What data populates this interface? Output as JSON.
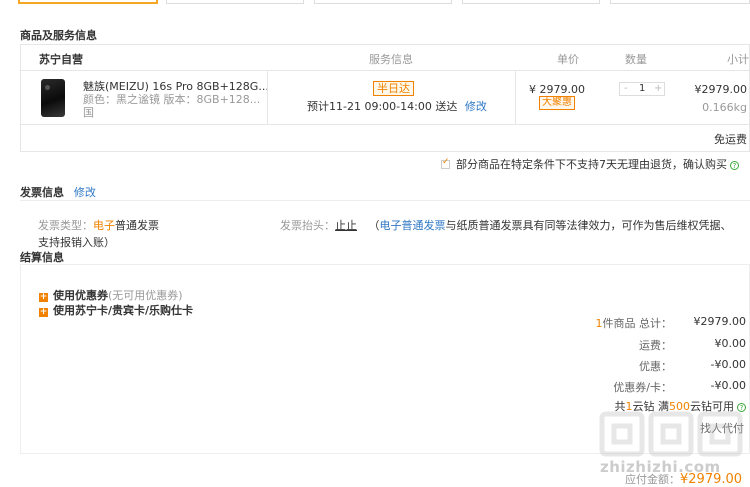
{
  "section_goods_title": "商品及服务信息",
  "table": {
    "seller": "苏宁自营",
    "col_service": "服务信息",
    "col_price": "单价",
    "col_qty": "数量",
    "col_subtotal": "小计"
  },
  "product": {
    "name": "魅族(MEIZU) 16s Pro 8GB+128G...",
    "spec_line": "颜色：黑之谧镜  版本：8GB+128...",
    "spec_more": "国",
    "service_badge": "半日达",
    "eta": "预计11-21 09:00-14:00 送达",
    "eta_edit": "修改",
    "unit_price": "¥ 2979.00",
    "promo_tag": "大聚惠",
    "qty_minus": "-",
    "qty": "1",
    "qty_plus": "+",
    "subtotal": "¥2979.00",
    "weight": "0.166kg",
    "shipping": "免运费"
  },
  "notice": {
    "text": "部分商品在特定条件下不支持7天无理由退货，确认购买",
    "help_icon": "question-circle-icon"
  },
  "invoice": {
    "title": "发票信息",
    "edit": "修改",
    "type_label": "发票类型：",
    "type_value_highlight": "电子",
    "type_value_rest": "普通发票",
    "header_label": "发票抬头：",
    "header_value": "止止",
    "note_prefix": "（",
    "note_link": "电子普通发票",
    "note_text": "与纸质普通发票具有同等法律效力，可作为售后维权凭据、",
    "note_line2": "支持报销入账）"
  },
  "settlement": {
    "title": "结算信息",
    "coupon_label": "使用优惠券",
    "coupon_note": "(无可用优惠券)",
    "card_label": "使用苏宁卡/贵宾卡/乐购仕卡",
    "items_count": "1",
    "items_label": "件商品 总计：",
    "items_total": "¥2979.00",
    "freight_label": "运费：",
    "freight_value": "¥0.00",
    "discount_label": "优惠：",
    "discount_value": "-¥0.00",
    "coupon_card_label": "优惠券/卡：",
    "coupon_card_value": "-¥0.00",
    "yun_prefix": "共",
    "yun_count": "1",
    "yun_mid": "云钻 满",
    "yun_threshold": "500",
    "yun_suffix": "云钻可用",
    "pay_text": "找人代付",
    "payable_label": "应付金额：",
    "payable_value": "¥2979.00"
  },
  "watermark": "zhizhizhi.com",
  "colors": {
    "accent": "#f08200",
    "link": "#2f78c4",
    "border": "#e6e6e6"
  }
}
